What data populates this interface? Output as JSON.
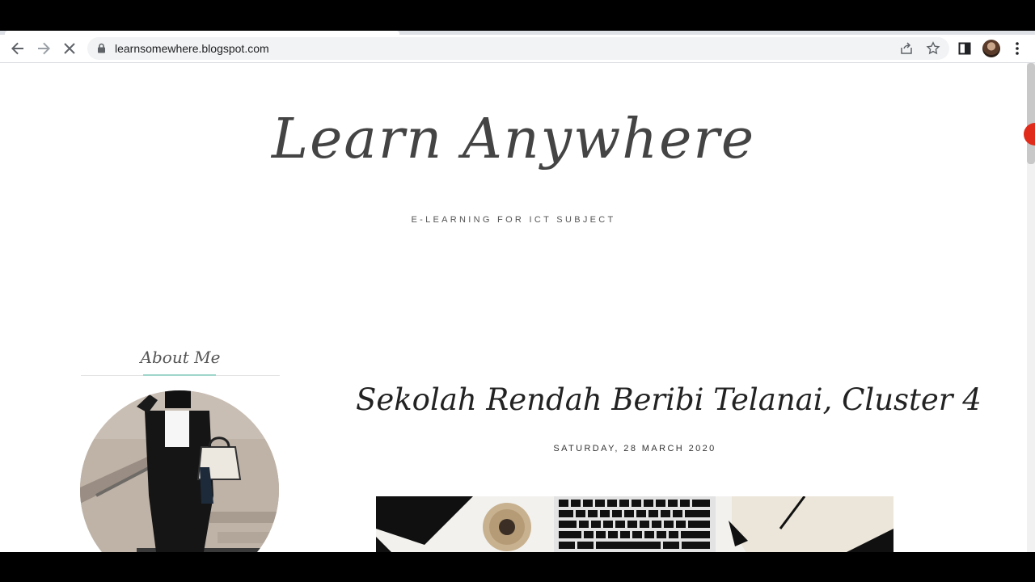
{
  "browser": {
    "url": "learnsomewhere.blogspot.com",
    "back_icon": "arrow-left-icon",
    "forward_icon": "arrow-right-icon",
    "stop_icon": "close-icon",
    "secure_icon": "lock-icon",
    "share_icon": "share-icon",
    "bookmark_icon": "star-icon",
    "sidepanel_icon": "side-panel-icon",
    "menu_icon": "kebab-menu-icon"
  },
  "blog": {
    "title": "Learn Anywhere",
    "tagline": "E-LEARNING FOR ICT SUBJECT"
  },
  "sidebar": {
    "about_heading": "About Me"
  },
  "post": {
    "title": "Sekolah Rendah Beribi Telanai, Cluster 4",
    "date": "SATURDAY, 28 MARCH 2020"
  },
  "colors": {
    "title_text": "#444444",
    "accent_underline": "#9fd6cc",
    "toolbar_bg": "#ffffff",
    "omnibox_bg": "#f1f3f4"
  }
}
